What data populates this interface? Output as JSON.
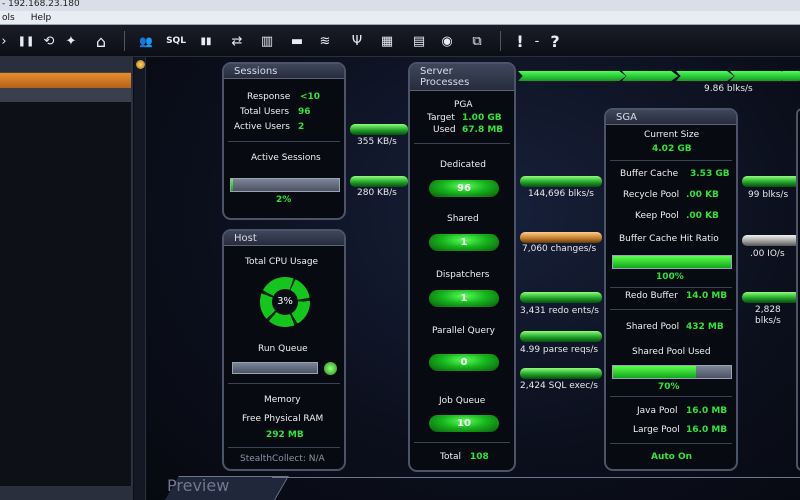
{
  "window": {
    "title": "- 192.168.23.180"
  },
  "menu": {
    "items": [
      "ols",
      "Help"
    ]
  },
  "toolbar": {
    "icons": [
      "pause-icon",
      "refresh-icon",
      "wand-icon",
      "home-icon",
      "users-icon",
      "sql-icon",
      "chart-icon",
      "swap-icon",
      "chip-icon",
      "window-icon",
      "stack-icon",
      "fork-icon",
      "disk-icon",
      "calendar-icon",
      "globe-icon",
      "db-icon",
      "alert-icon",
      "help-icon"
    ],
    "glyphs": {
      "pause": "❚❚",
      "refresh": "⟲",
      "wand": "✦",
      "home": "⌂",
      "users": "👥",
      "sql": "SQL",
      "chart": "▮▮",
      "swap": "⇄",
      "chip": "▥",
      "window": "▬",
      "stack": "≋",
      "fork": "Ψ",
      "disk": "▦",
      "calendar": "▤",
      "globe": "◉",
      "db": "⧉",
      "alert": "!",
      "dash": "-",
      "help": "?"
    }
  },
  "sessions": {
    "title": "Sessions",
    "response_label": "Response",
    "response_value": "<10",
    "total_users_label": "Total Users",
    "total_users_value": "96",
    "active_users_label": "Active Users",
    "active_users_value": "2",
    "active_sessions_label": "Active Sessions",
    "active_sessions_value": "2%",
    "active_sessions_fraction": 0.02
  },
  "host": {
    "title": "Host",
    "cpu_label": "Total CPU Usage",
    "cpu_value": "3%",
    "run_queue_label": "Run Queue",
    "memory_label": "Memory",
    "free_ram_label": "Free Physical RAM",
    "free_ram_value": "292 MB",
    "stealth_label": "StealthCollect: N/A"
  },
  "server": {
    "title_line1": "Server",
    "title_line2": "Processes",
    "pga_label": "PGA",
    "target_label": "Target",
    "target_value": "1.00 GB",
    "used_label": "Used",
    "used_value": "67.8 MB",
    "dedicated_label": "Dedicated",
    "dedicated_value": "96",
    "shared_label": "Shared",
    "shared_value": "1",
    "dispatchers_label": "Dispatchers",
    "dispatchers_value": "1",
    "parallel_label": "Parallel Query",
    "parallel_value": "0",
    "job_label": "Job Queue",
    "job_value": "10",
    "total_label": "Total",
    "total_value": "108"
  },
  "sga": {
    "title": "SGA",
    "current_size_label": "Current Size",
    "current_size_value": "4.02 GB",
    "buffer_cache_label": "Buffer Cache",
    "buffer_cache_value": "3.53 GB",
    "recycle_label": "Recycle Pool",
    "recycle_value": ".00 KB",
    "keep_label": "Keep Pool",
    "keep_value": ".00 KB",
    "hit_ratio_label": "Buffer Cache Hit Ratio",
    "hit_ratio_value": "100%",
    "hit_ratio_fraction": 1.0,
    "redo_label": "Redo Buffer",
    "redo_value": "14.0 MB",
    "shared_pool_label": "Shared Pool",
    "shared_pool_value": "432 MB",
    "shared_used_label": "Shared Pool Used",
    "shared_used_value": "70%",
    "shared_used_fraction": 0.7,
    "java_label": "Java Pool",
    "java_value": "16.0 MB",
    "large_label": "Large Pool",
    "large_value": "16.0 MB",
    "auto_label": "Auto On"
  },
  "flows": {
    "sessions_top": "355 KB/s",
    "sessions_bottom": "280 KB/s",
    "top_right": "9.86 blks/s",
    "blks": "144,696 blks/s",
    "changes": "7,060 changes/s",
    "redo": "3,431 redo ents/s",
    "parse": "4.99 parse reqs/s",
    "sql": "2,424 SQL exec/s",
    "right_blks": "99 blks/s",
    "right_io": ".00 IO/s",
    "right_blks2_line1": "2,828",
    "right_blks2_line2": "blks/s"
  },
  "preview": {
    "label": "Preview"
  }
}
